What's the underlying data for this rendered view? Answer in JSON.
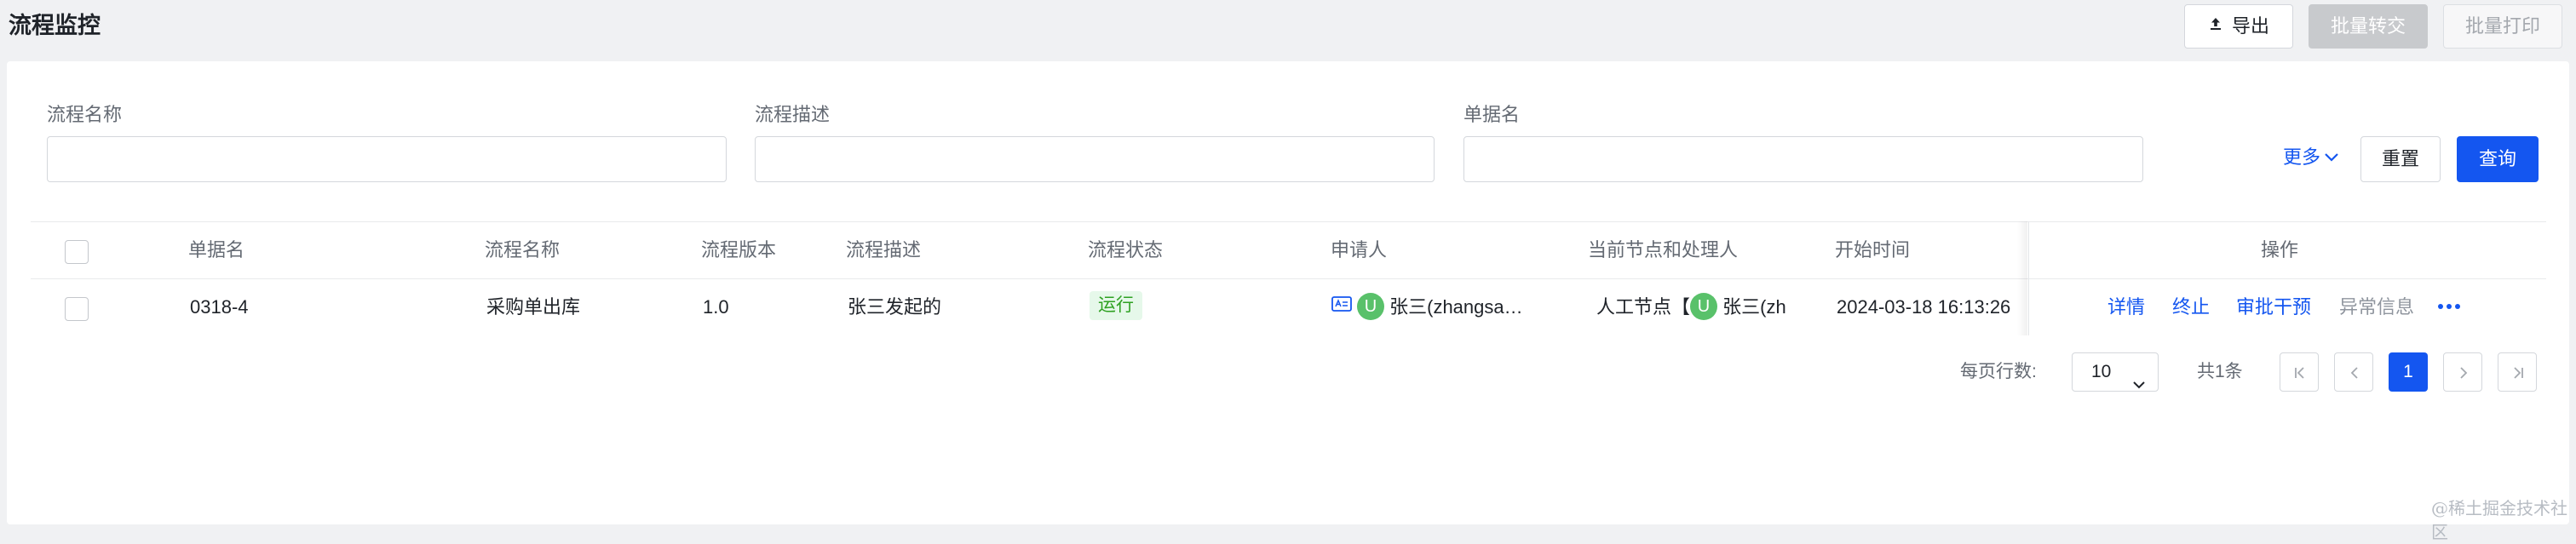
{
  "header": {
    "title": "流程监控",
    "export_label": "导出",
    "batch_transfer_label": "批量转交",
    "batch_print_label": "批量打印"
  },
  "filters": {
    "process_name_label": "流程名称",
    "process_desc_label": "流程描述",
    "doc_name_label": "单据名",
    "more_label": "更多",
    "reset_label": "重置",
    "query_label": "查询"
  },
  "table": {
    "columns": [
      "单据名",
      "流程名称",
      "流程版本",
      "流程描述",
      "流程状态",
      "申请人",
      "当前节点和处理人",
      "开始时间",
      "操作"
    ],
    "rows": [
      {
        "doc_name": "0318-4",
        "process_name": "采购单出库",
        "version": "1.0",
        "description": "张三发起的",
        "status": "运行",
        "applicant_avatar": "U",
        "applicant": "张三(zhangsa…",
        "current_node": "人工节点【",
        "handler_avatar": "U",
        "handler": "张三(zh",
        "start_time": "2024-03-18 16:13:26",
        "actions": [
          "详情",
          "终止",
          "审批干预",
          "异常信息"
        ]
      }
    ]
  },
  "pagination": {
    "rows_per_page_label": "每页行数:",
    "rows_per_page_value": "10",
    "total_label": "共1条",
    "current_page": "1"
  },
  "watermark": "@稀土掘金技术社区",
  "colors": {
    "primary": "#1456f0",
    "status_running_bg": "#e6f8ea",
    "status_running_text": "#2ea121",
    "avatar": "#59c16a"
  }
}
